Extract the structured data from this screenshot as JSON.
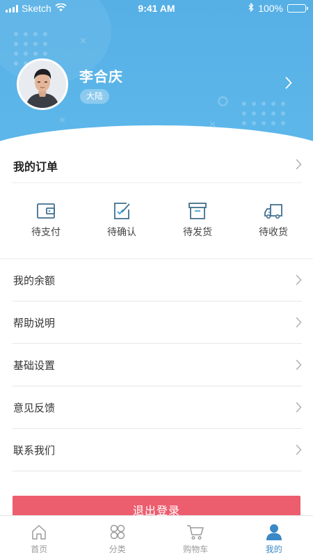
{
  "status_bar": {
    "carrier": "Sketch",
    "time": "9:41 AM",
    "battery": "100%"
  },
  "profile": {
    "name": "李合庆",
    "region": "大陆"
  },
  "orders": {
    "title": "我的订单",
    "types": [
      {
        "label": "待支付",
        "icon": "wallet-icon"
      },
      {
        "label": "待确认",
        "icon": "edit-check-icon"
      },
      {
        "label": "待发货",
        "icon": "box-icon"
      },
      {
        "label": "待收货",
        "icon": "truck-icon"
      }
    ]
  },
  "menu": {
    "items": [
      {
        "label": "我的余额"
      },
      {
        "label": "帮助说明"
      },
      {
        "label": "基础设置"
      },
      {
        "label": "意见反馈"
      },
      {
        "label": "联系我们"
      }
    ]
  },
  "logout_label": "退出登录",
  "tabbar": {
    "tabs": [
      {
        "label": "首页",
        "icon": "home-icon"
      },
      {
        "label": "分类",
        "icon": "category-icon"
      },
      {
        "label": "购物车",
        "icon": "cart-icon"
      },
      {
        "label": "我的",
        "icon": "user-icon",
        "active": true
      }
    ]
  },
  "colors": {
    "header": "#5db7ea",
    "logout": "#ec5d6e",
    "tab_active": "#3a88c6",
    "icon": "#3f6f8f"
  }
}
